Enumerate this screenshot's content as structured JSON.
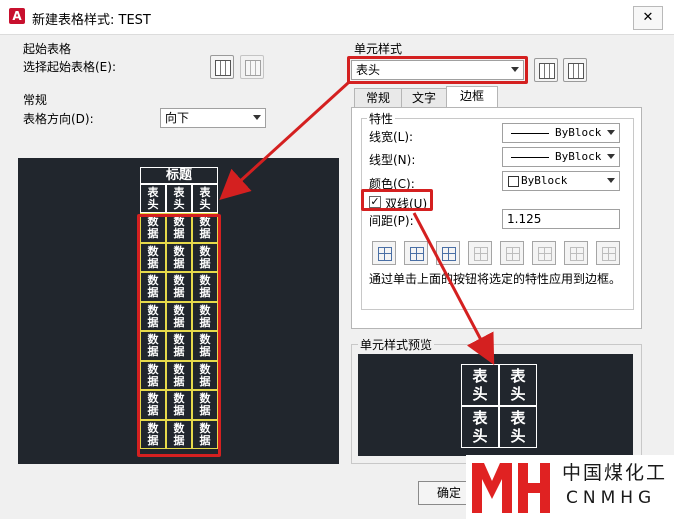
{
  "window": {
    "title": "新建表格样式: TEST",
    "app_icon": "A",
    "close_glyph": "✕"
  },
  "starting_table": {
    "group_label": "起始表格",
    "select_label": "选择起始表格(E):",
    "icons": [
      "select-table-icon",
      "remove-table-icon"
    ]
  },
  "general": {
    "group_label": "常规",
    "direction_label": "表格方向(D):",
    "direction_value": "向下"
  },
  "cell_style": {
    "group_label": "单元样式",
    "selected": "表头",
    "icons": [
      "create-cell-style-icon",
      "manage-cell-styles-icon"
    ],
    "tabs": [
      {
        "label": "常规",
        "active": false
      },
      {
        "label": "文字",
        "active": false
      },
      {
        "label": "边框",
        "active": true
      }
    ]
  },
  "properties": {
    "group_label": "特性",
    "lineweight_label": "线宽(L):",
    "lineweight_value": "ByBlock",
    "linetype_label": "线型(N):",
    "linetype_value": "ByBlock",
    "color_label": "颜色(C):",
    "color_value": "ByBlock",
    "double_line_label": "双线(U)",
    "double_line_checked": "✓",
    "spacing_label": "间距(P):",
    "spacing_value": "1.125",
    "border_buttons": [
      "all-borders-icon",
      "outside-borders-icon",
      "inside-borders-icon",
      "bottom-border-icon",
      "left-border-icon",
      "top-border-icon",
      "right-border-icon",
      "no-border-icon"
    ],
    "hint": "通过单击上面的按钮将选定的特性应用到边框。"
  },
  "table_preview": {
    "title": "标题",
    "header_cell": "表\n头",
    "data_cell": "数\n据",
    "header_cols": 3,
    "data_rows": 8
  },
  "cell_preview": {
    "group_label": "单元样式预览",
    "cell": "表\n头"
  },
  "buttons": {
    "ok": "确定"
  },
  "watermark": {
    "logo": "MH",
    "name": "中国煤化工",
    "letters": "CNMHG"
  },
  "colors": {
    "highlight": "#d42020",
    "preview_bg": "#21262d",
    "data_border": "#e6d94a"
  }
}
